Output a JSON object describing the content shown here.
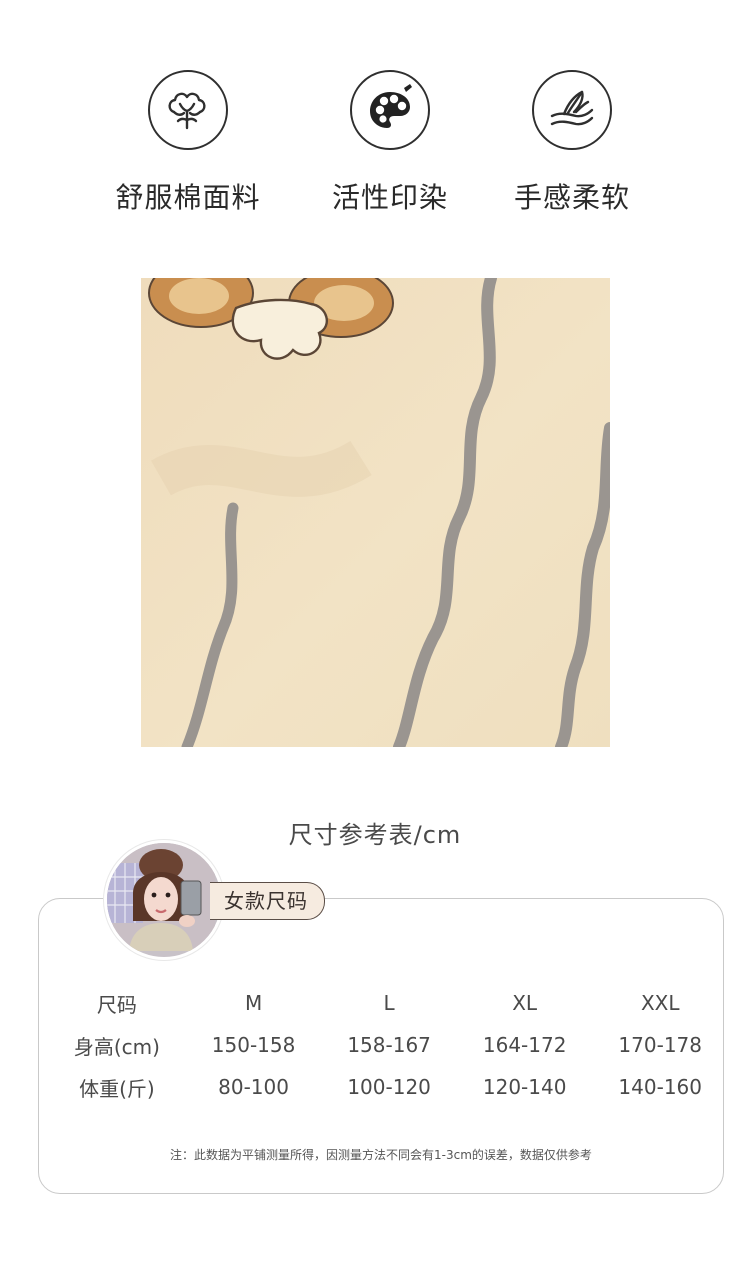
{
  "features": [
    {
      "icon": "cotton-flower-icon",
      "label": "舒服棉面料"
    },
    {
      "icon": "paint-palette-icon",
      "label": "活性印染"
    },
    {
      "icon": "hand-feather-icon",
      "label": "手感柔软"
    }
  ],
  "size_chart": {
    "title": "尺寸参考表/cm",
    "tag": "女款尺码",
    "header": {
      "label": "尺码",
      "cols": [
        "M",
        "L",
        "XL",
        "XXL"
      ]
    },
    "rows": [
      {
        "label": "身高(cm)",
        "values": [
          "150-158",
          "158-167",
          "164-172",
          "170-178"
        ]
      },
      {
        "label": "体重(斤)",
        "values": [
          "80-100",
          "100-120",
          "120-140",
          "140-160"
        ]
      }
    ],
    "note": "注：此数据为平铺测量所得，因测量方法不同会有1-3cm的误差，数据仅供参考"
  },
  "colors": {
    "fabric": "#f1e2c3",
    "stripe": "#9a9590",
    "tag_bg": "#f6ebe0",
    "card_border": "#c9c9c9"
  }
}
